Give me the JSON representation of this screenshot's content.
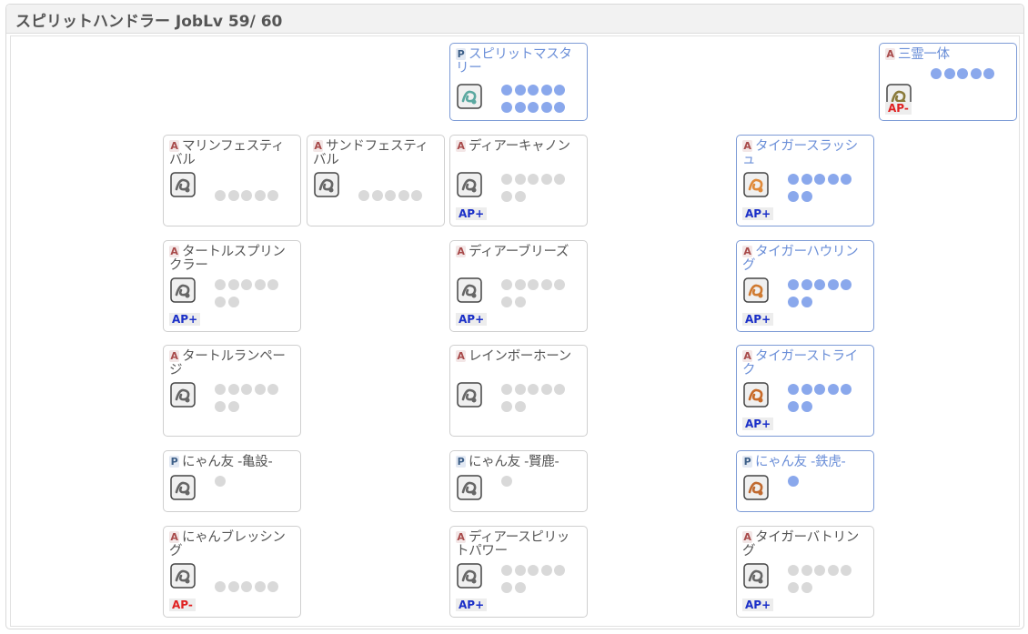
{
  "header": {
    "title": "スピリットハンドラー JobLv 59/ 60"
  },
  "skills": [
    {
      "id": "spirit-mastery",
      "type": "P",
      "name": "スピリットマスタリー",
      "learned": true,
      "dots": 10,
      "ap": "",
      "icon": "spirit-orb-icon",
      "icon_color": "#5aa8a0"
    },
    {
      "id": "sanrei-ittai",
      "type": "A",
      "name": "三霊一体",
      "learned": true,
      "dots": 5,
      "ap": "AP-",
      "icon": "three-spirits-icon",
      "icon_color": "#8a7a3a"
    },
    {
      "id": "marine-festival",
      "type": "A",
      "name": "マリンフェスティバル",
      "learned": false,
      "dots": 5,
      "ap": "",
      "icon": "wave-icon",
      "icon_color": "#666666"
    },
    {
      "id": "sand-festival",
      "type": "A",
      "name": "サンドフェスティバル",
      "learned": false,
      "dots": 5,
      "ap": "",
      "icon": "sand-swirl-icon",
      "icon_color": "#666666"
    },
    {
      "id": "deer-cannon",
      "type": "A",
      "name": "ディアーキャノン",
      "learned": false,
      "dots": 7,
      "ap": "AP+",
      "icon": "beam-icon",
      "icon_color": "#666666"
    },
    {
      "id": "tiger-slash",
      "type": "A",
      "name": "タイガースラッシュ",
      "learned": true,
      "dots": 7,
      "ap": "AP+",
      "icon": "claw-slash-icon",
      "icon_color": "#e08a3a"
    },
    {
      "id": "turtle-sprinkler",
      "type": "A",
      "name": "タートルスプリンクラー",
      "learned": false,
      "dots": 7,
      "ap": "AP+",
      "icon": "sprinkler-icon",
      "icon_color": "#666666"
    },
    {
      "id": "deer-breeze",
      "type": "A",
      "name": "ディアーブリーズ",
      "learned": false,
      "dots": 7,
      "ap": "AP+",
      "icon": "breeze-icon",
      "icon_color": "#666666"
    },
    {
      "id": "tiger-howling",
      "type": "A",
      "name": "タイガーハウリング",
      "learned": true,
      "dots": 7,
      "ap": "AP+",
      "icon": "tiger-face-icon",
      "icon_color": "#d07a30"
    },
    {
      "id": "turtle-rampage",
      "type": "A",
      "name": "タートルランページ",
      "learned": false,
      "dots": 7,
      "ap": "",
      "icon": "turtle-icon",
      "icon_color": "#666666"
    },
    {
      "id": "rainbow-horn",
      "type": "A",
      "name": "レインボーホーン",
      "learned": false,
      "dots": 7,
      "ap": "",
      "icon": "horn-icon",
      "icon_color": "#666666"
    },
    {
      "id": "tiger-strike",
      "type": "A",
      "name": "タイガーストライク",
      "learned": true,
      "dots": 7,
      "ap": "AP+",
      "icon": "tiger-pounce-icon",
      "icon_color": "#c86a28"
    },
    {
      "id": "nyan-kame",
      "type": "P",
      "name": "にゃん友 -亀設-",
      "learned": false,
      "dots": 1,
      "ap": "",
      "icon": "cat-turtle-icon",
      "icon_color": "#666666"
    },
    {
      "id": "nyan-roku",
      "type": "P",
      "name": "にゃん友 -賢鹿-",
      "learned": false,
      "dots": 1,
      "ap": "",
      "icon": "cat-deer-icon",
      "icon_color": "#666666"
    },
    {
      "id": "nyan-tora",
      "type": "P",
      "name": "にゃん友 -鉄虎-",
      "learned": true,
      "dots": 1,
      "ap": "",
      "icon": "cat-tiger-icon",
      "icon_color": "#c06a30"
    },
    {
      "id": "nyan-blessing",
      "type": "A",
      "name": "にゃんブレッシング",
      "learned": false,
      "dots": 5,
      "ap": "AP-",
      "icon": "cat-blessing-icon",
      "icon_color": "#666666"
    },
    {
      "id": "deer-spirit-power",
      "type": "A",
      "name": "ディアースピリットパワー",
      "learned": false,
      "dots": 7,
      "ap": "AP+",
      "icon": "deer-spirit-icon",
      "icon_color": "#666666"
    },
    {
      "id": "tiger-battle",
      "type": "A",
      "name": "タイガーバトリング",
      "learned": false,
      "dots": 7,
      "ap": "AP+",
      "icon": "tiger-battle-icon",
      "icon_color": "#666666"
    }
  ]
}
